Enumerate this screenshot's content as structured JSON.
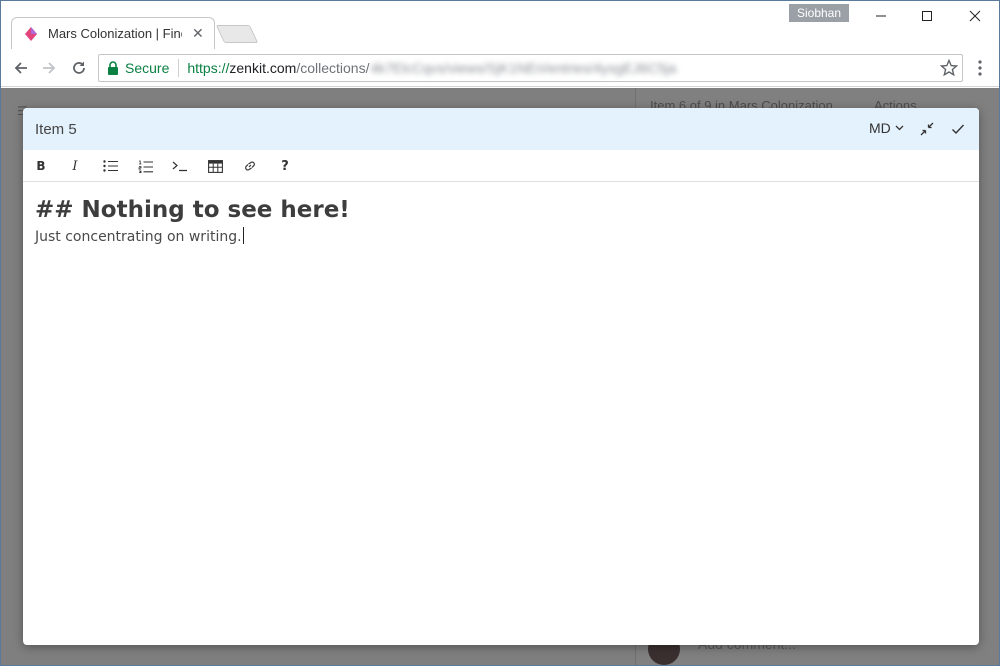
{
  "browser": {
    "tab_title": "Mars Colonization | Find",
    "profile_name": "Siobhan",
    "url_secure_label": "Secure",
    "url_scheme": "https://",
    "url_host": "zenkit.com",
    "url_path": "/collections/",
    "url_blurred": "4k7ElcCqvs/views/SjK1NEri/entries/4ysgEJ6C5ja"
  },
  "background_page": {
    "side_header": "Item 6 of 9 in Mars Colonization",
    "side_actions": "Actions",
    "comment_placeholder": "Add comment..."
  },
  "modal": {
    "title": "Item 5",
    "format_value": "MD",
    "toolbar": {
      "bold": "B",
      "italic": "I",
      "help": "?"
    },
    "content": {
      "heading": "## Nothing to see here!",
      "text": "Just concentrating on writing."
    }
  },
  "colors": {
    "header_bg": "#e3f2fc",
    "secure_green": "#0b8043",
    "backdrop": "#7f7f7f"
  }
}
